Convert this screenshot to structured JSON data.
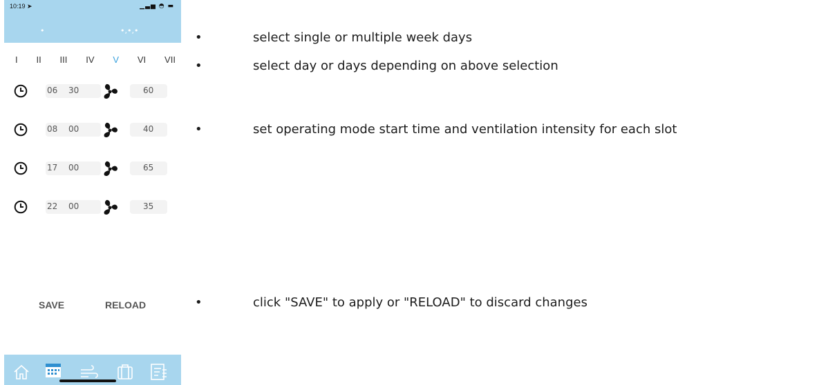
{
  "status_bar": {
    "time": "10:19",
    "location_glyph": "➤",
    "signal_icons": "▁▃▅ ◓ ▬"
  },
  "mode_selector": {
    "single": "•",
    "multiple": "•,•,•"
  },
  "weekdays": [
    "I",
    "II",
    "III",
    "IV",
    "V",
    "VI",
    "VII"
  ],
  "selected_weekday": "V",
  "slots": [
    {
      "hour": "06",
      "minute": "30",
      "intensity": "60"
    },
    {
      "hour": "08",
      "minute": "00",
      "intensity": "40"
    },
    {
      "hour": "17",
      "minute": "00",
      "intensity": "65"
    },
    {
      "hour": "22",
      "minute": "00",
      "intensity": "35"
    }
  ],
  "actions": {
    "save": "SAVE",
    "reload": "RELOAD"
  },
  "tabs": [
    "home-icon",
    "calendar-icon",
    "wind-icon",
    "suitcase-icon",
    "settings-list-icon"
  ],
  "colors": {
    "accent": "#3aa1dd",
    "bar": "#a8d6ee"
  },
  "notes": [
    {
      "bullet": "•",
      "text": "select single or multiple week days"
    },
    {
      "bullet": "•",
      "text": "select day or days depending on above selection"
    },
    {
      "bullet": "•",
      "text": "set operating mode start time and ventilation intensity for each slot"
    },
    {
      "bullet": "•",
      "text": "click \"SAVE\" to apply or \"RELOAD\" to discard changes"
    }
  ]
}
